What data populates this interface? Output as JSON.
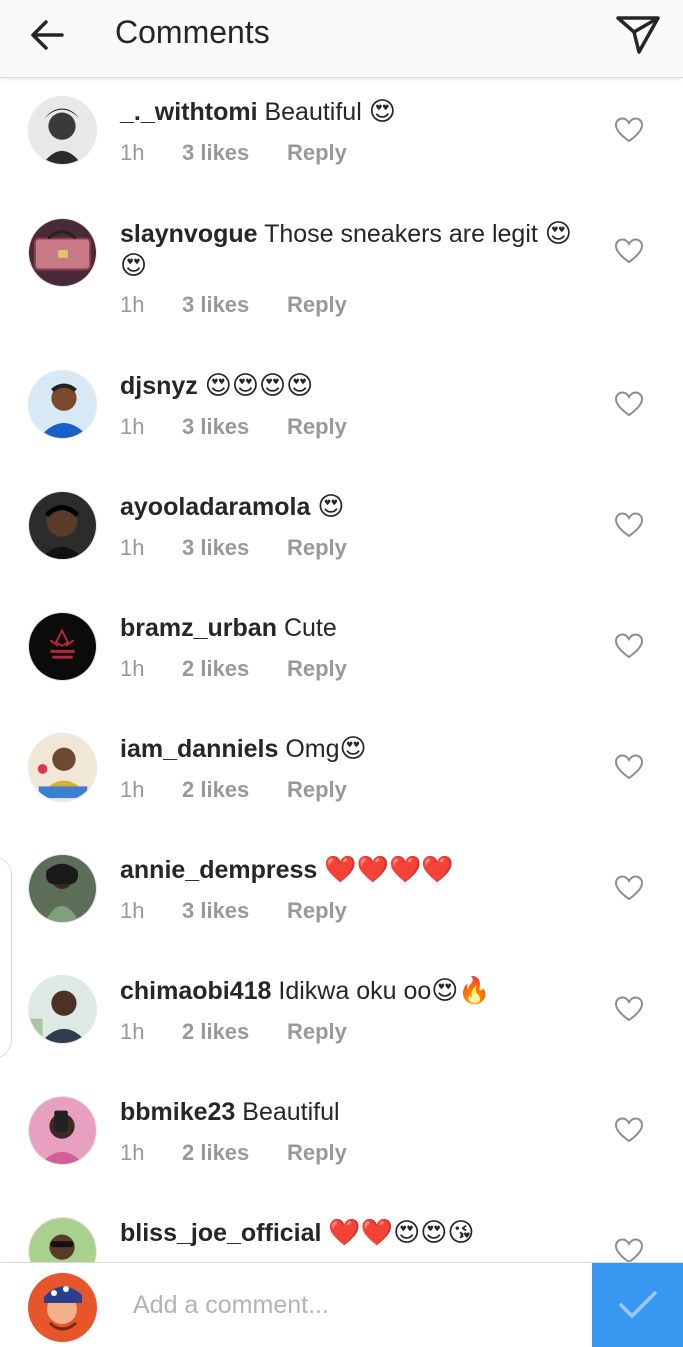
{
  "header": {
    "title": "Comments",
    "back_icon": "arrow-left-icon",
    "send_icon": "paper-plane-icon"
  },
  "comments": [
    {
      "username": "_._withtomi",
      "text": "Beautiful",
      "emoji": "😍",
      "time": "1h",
      "likes": "3 likes",
      "reply": "Reply"
    },
    {
      "username": "slaynvogue",
      "text": "Those sneakers are legit",
      "emoji": "😍 😍",
      "time": "1h",
      "likes": "3 likes",
      "reply": "Reply"
    },
    {
      "username": "djsnyz",
      "text": "",
      "emoji": "😍😍😍😍",
      "time": "1h",
      "likes": "3 likes",
      "reply": "Reply"
    },
    {
      "username": "ayooladaramola",
      "text": "",
      "emoji": "😍",
      "time": "1h",
      "likes": "3 likes",
      "reply": "Reply"
    },
    {
      "username": "bramz_urban",
      "text": "Cute",
      "emoji": "",
      "time": "1h",
      "likes": "2 likes",
      "reply": "Reply"
    },
    {
      "username": "iam_danniels",
      "text": "Omg",
      "emoji": "😍",
      "time": "1h",
      "likes": "2 likes",
      "reply": "Reply"
    },
    {
      "username": "annie_dempress",
      "text": "",
      "emoji": "❤️❤️❤️❤️",
      "time": "1h",
      "likes": "3 likes",
      "reply": "Reply"
    },
    {
      "username": "chimaobi418",
      "text": "Idikwa oku oo",
      "emoji": "😍🔥",
      "time": "1h",
      "likes": "2 likes",
      "reply": "Reply"
    },
    {
      "username": "bbmike23",
      "text": "Beautiful",
      "emoji": "",
      "time": "1h",
      "likes": "2 likes",
      "reply": "Reply"
    },
    {
      "username": "bliss_joe_official",
      "text": "",
      "emoji": "❤️❤️😍😍😘",
      "time": "",
      "likes": "",
      "reply": ""
    }
  ],
  "composer": {
    "placeholder": "Add a comment...",
    "post_icon": "checkmark-icon"
  },
  "colors": {
    "accent": "#3897f0",
    "heart_love": "#ed4956",
    "meta_gray": "#999999",
    "text": "#262626"
  }
}
